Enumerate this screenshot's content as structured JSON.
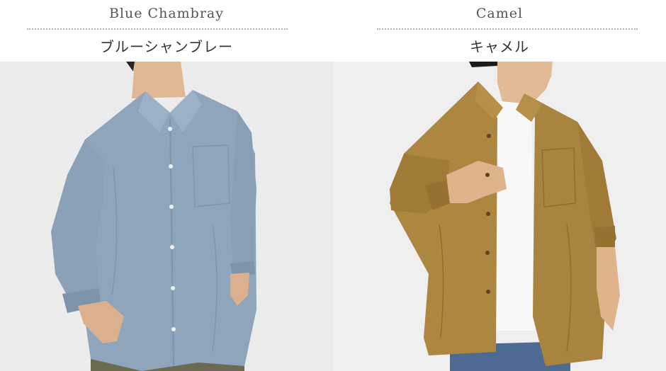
{
  "products": [
    {
      "color_en": "Blue Chambray",
      "color_ja": "ブルーシャンブレー",
      "shirt_color": "#8fa5bb"
    },
    {
      "color_en": "Camel",
      "color_ja": "キャメル",
      "shirt_color": "#ad8740"
    }
  ]
}
